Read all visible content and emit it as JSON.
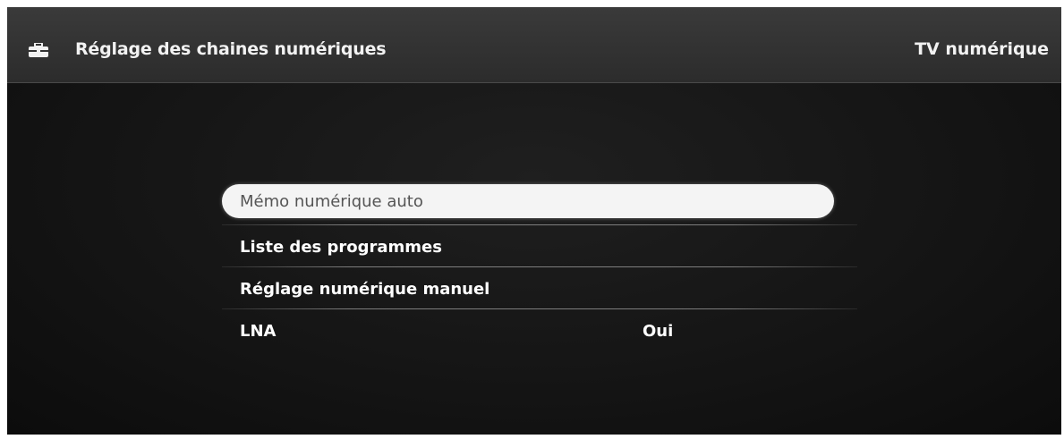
{
  "header": {
    "icon": "toolbox-icon",
    "title": "Réglage des chaines numériques",
    "source": "TV numérique"
  },
  "menu": {
    "items": [
      {
        "label": "Mémo numérique auto",
        "value": "",
        "selected": true
      },
      {
        "label": "Liste des programmes",
        "value": "",
        "selected": false
      },
      {
        "label": "Réglage numérique manuel",
        "value": "",
        "selected": false
      },
      {
        "label": "LNA",
        "value": "Oui",
        "selected": false
      }
    ]
  }
}
